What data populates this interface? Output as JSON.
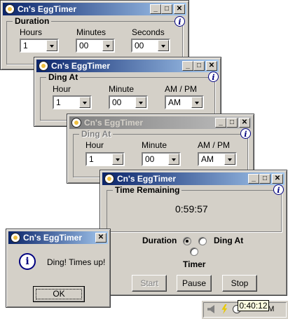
{
  "window1": {
    "title": "Cn's EggTimer",
    "group_title": "Duration",
    "hours_label": "Hours",
    "minutes_label": "Minutes",
    "seconds_label": "Seconds",
    "hours_value": "1",
    "minutes_value": "00",
    "seconds_value": "00"
  },
  "window2": {
    "title": "Cn's EggTimer",
    "group_title": "Ding At",
    "hour_label": "Hour",
    "minute_label": "Minute",
    "ampm_label": "AM / PM",
    "hour_value": "1",
    "minute_value": "00",
    "ampm_value": "AM"
  },
  "window3": {
    "title": "Cn's EggTimer",
    "group_title": "Ding At",
    "hour_label": "Hour",
    "minute_label": "Minute",
    "ampm_label": "AM / PM",
    "hour_value": "1",
    "minute_value": "00",
    "ampm_value": "AM"
  },
  "window4": {
    "title": "Cn's EggTimer",
    "group_title": "Time Remaining",
    "time_remaining": "0:59:57",
    "mode_duration": "Duration",
    "mode_ding_at": "Ding At",
    "mode_timer": "Timer",
    "selected_mode": "Duration",
    "start_label": "Start",
    "pause_label": "Pause",
    "stop_label": "Stop"
  },
  "dialog": {
    "title": "Cn's EggTimer",
    "message": "Ding! Times up!",
    "ok_label": "OK"
  },
  "taskbar": {
    "clock": "2:29 AM",
    "tooltip": "0:40:12"
  },
  "titlebar_buttons": {
    "minimize": "_",
    "maximize": "□",
    "close": "✕"
  },
  "info_glyph": "i",
  "colors": {
    "active_title_start": "#0a246a",
    "active_title_end": "#a6caf0",
    "face": "#d4d0c8"
  }
}
